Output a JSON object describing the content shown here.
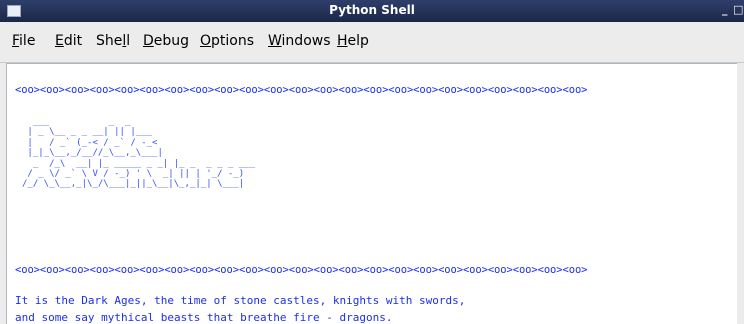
{
  "window": {
    "title": "Python Shell",
    "controls": {
      "minimize": "_",
      "maximize": "□"
    }
  },
  "menubar": {
    "items": [
      {
        "label_pre": "",
        "mnemonic": "F",
        "label_post": "ile"
      },
      {
        "label_pre": "",
        "mnemonic": "E",
        "label_post": "dit"
      },
      {
        "label_pre": "She",
        "mnemonic": "l",
        "label_post": "l"
      },
      {
        "label_pre": "",
        "mnemonic": "D",
        "label_post": "ebug"
      },
      {
        "label_pre": "",
        "mnemonic": "O",
        "label_post": "ptions"
      },
      {
        "label_pre": "",
        "mnemonic": "W",
        "label_post": "indows"
      },
      {
        "label_pre": "",
        "mnemonic": "H",
        "label_post": "elp"
      }
    ]
  },
  "shell": {
    "separator_top": "<oo><oo><oo><oo><oo><oo><oo><oo><oo><oo><oo><oo><oo><oo><oo><oo><oo><oo><oo><oo><oo><oo><oo>",
    "banner_lines": [
      "  ___           _  _",
      " | _ \\__ _ _ __| || |___",
      " |   / _` (_-< / _` / -_<",
      " |_|_\\__,_/__//_\\__,_\\___|",
      "  _  /_\\  __| |_ _____ _ _| |_ _  _ _ _ ___",
      " / _ \\/ _` \\ V / -_) ' \\  _| || | '_/ -_)",
      "/_/ \\_\\__,_|\\_/\\___|_||_\\__|\\_,_|_| \\___|"
    ],
    "separator_bottom": "<oo><oo><oo><oo><oo><oo><oo><oo><oo><oo><oo><oo><oo><oo><oo><oo><oo><oo><oo><oo><oo><oo><oo>",
    "intro_lines": [
      "It is the Dark Ages, the time of stone castles, knights with swords,",
      "and some say mythical beasts that breathe fire - dragons."
    ]
  }
}
